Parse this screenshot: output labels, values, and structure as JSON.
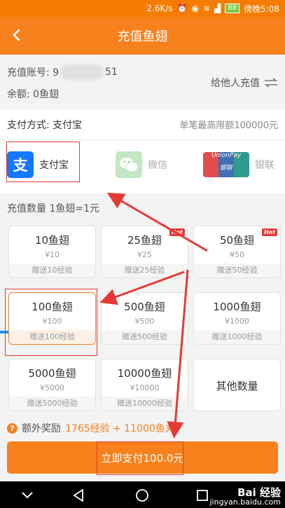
{
  "status_bar": {
    "speed": "2.6K/s",
    "battery": "88",
    "carrier": "傍晚5:08"
  },
  "header": {
    "title": "充值鱼翅"
  },
  "account": {
    "label": "充值账号: 9",
    "suffix": "51",
    "balance": "余额: 0鱼翅",
    "other_label": "给他人充值"
  },
  "payment": {
    "method_label": "支付方式: 支付宝",
    "limit": "单笔最高限额100000元"
  },
  "methods": [
    {
      "label": "支付宝"
    },
    {
      "label": "微信"
    },
    {
      "label": "银联"
    }
  ],
  "unionpay_logo": {
    "line1": "UnionPay",
    "line2": "银联"
  },
  "quantity_title": "充值数量 1鱼翅=1元",
  "options": [
    {
      "amount": "10鱼翅",
      "price": "¥10",
      "bonus": "赠送10经验"
    },
    {
      "amount": "25鱼翅",
      "price": "¥25",
      "bonus": "赠送25经验",
      "hot": "Hot"
    },
    {
      "amount": "50鱼翅",
      "price": "¥50",
      "bonus": "赠送50经验",
      "hot": "Hot"
    },
    {
      "amount": "100鱼翅",
      "price": "¥100",
      "bonus": "赠送100经验"
    },
    {
      "amount": "500鱼翅",
      "price": "¥500",
      "bonus": "赠送500经验"
    },
    {
      "amount": "1000鱼翅",
      "price": "¥1000",
      "bonus": "赠送1000经验"
    },
    {
      "amount": "5000鱼翅",
      "price": "¥5000",
      "bonus": "赠送5000经验"
    },
    {
      "amount": "10000鱼翅",
      "price": "¥10000",
      "bonus": "赠送10000经验"
    }
  ],
  "other_option": "其他数量",
  "extra": {
    "label": "额外奖励",
    "value": "1765经验 + 11000鱼丸"
  },
  "pay_button": "立即支付100.0元",
  "watermark": {
    "line1": "Bai 经验",
    "line2": "jingyan.baidu.com"
  },
  "colors": {
    "accent": "#f7811d",
    "annotation": "#e53935",
    "alipay": "#1677ff"
  }
}
